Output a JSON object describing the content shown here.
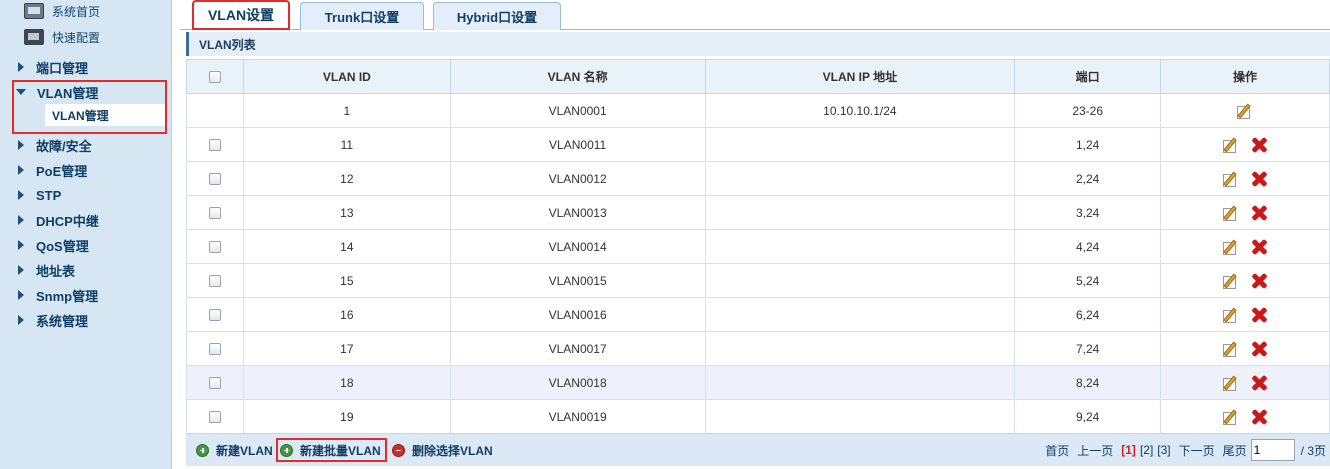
{
  "sidebar": {
    "top_links": [
      "系统首页",
      "快速配置"
    ],
    "menu": [
      "端口管理",
      "VLAN管理",
      "故障/安全",
      "PoE管理",
      "STP",
      "DHCP中继",
      "QoS管理",
      "地址表",
      "Snmp管理",
      "系统管理"
    ],
    "submenu_vlan": "VLAN管理"
  },
  "tabs": [
    "VLAN设置",
    "Trunk口设置",
    "Hybrid口设置"
  ],
  "list_title": "VLAN列表",
  "table": {
    "headers": [
      "VLAN ID",
      "VLAN 名称",
      "VLAN IP 地址",
      "端口",
      "操作"
    ],
    "rows": [
      {
        "id": "1",
        "name": "VLAN0001",
        "ip": "10.10.10.1/24",
        "ports": "23-26"
      },
      {
        "id": "11",
        "name": "VLAN0011",
        "ip": "",
        "ports": "1,24"
      },
      {
        "id": "12",
        "name": "VLAN0012",
        "ip": "",
        "ports": "2,24"
      },
      {
        "id": "13",
        "name": "VLAN0013",
        "ip": "",
        "ports": "3,24"
      },
      {
        "id": "14",
        "name": "VLAN0014",
        "ip": "",
        "ports": "4,24"
      },
      {
        "id": "15",
        "name": "VLAN0015",
        "ip": "",
        "ports": "5,24"
      },
      {
        "id": "16",
        "name": "VLAN0016",
        "ip": "",
        "ports": "6,24"
      },
      {
        "id": "17",
        "name": "VLAN0017",
        "ip": "",
        "ports": "7,24"
      },
      {
        "id": "18",
        "name": "VLAN0018",
        "ip": "",
        "ports": "8,24"
      },
      {
        "id": "19",
        "name": "VLAN0019",
        "ip": "",
        "ports": "9,24"
      }
    ]
  },
  "footer": {
    "new_vlan": "新建VLAN",
    "new_batch_vlan": "新建批量VLAN",
    "delete_selected": "删除选择VLAN"
  },
  "pager": {
    "first": "首页",
    "prev": "上一页",
    "page1": "[1]",
    "page2": "[2]",
    "page3": "[3]",
    "next": "下一页",
    "last": "尾页",
    "input_value": "1",
    "total": "/ 3页"
  },
  "colors": {
    "highlight_border": "#e32b2b",
    "sidebar_bg": "#d6e6f3",
    "link_text": "#133d63"
  }
}
